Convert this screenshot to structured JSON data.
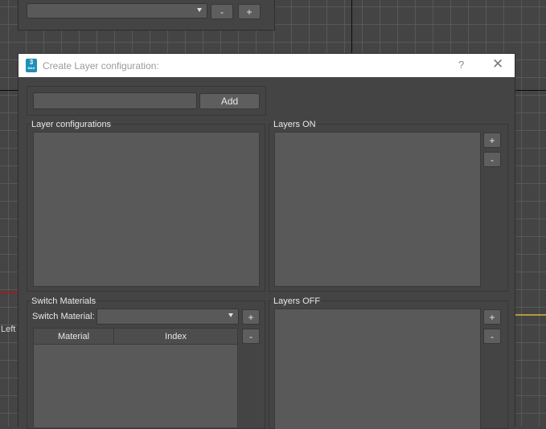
{
  "viewport": {
    "label": "Left"
  },
  "top_panel": {
    "dropdown_value": "",
    "minus_label": "-",
    "plus_label": "+"
  },
  "dialog": {
    "title": "Create Layer configuration:",
    "icon_text": "3",
    "icon_subtext": "MAX",
    "help_symbol": "?",
    "close_symbol": "✕",
    "add_input_value": "",
    "add_button_label": "Add",
    "layer_configurations": {
      "title": "Layer configurations",
      "items": []
    },
    "layers_on": {
      "title": "Layers ON",
      "plus_label": "+",
      "minus_label": "-",
      "items": []
    },
    "switch_materials": {
      "title": "Switch Materials",
      "switch_label": "Switch Material:",
      "dropdown_value": "",
      "plus_label": "+",
      "minus_label": "-",
      "columns": [
        "Material",
        "Index"
      ],
      "rows": []
    },
    "layers_off": {
      "title": "Layers OFF",
      "plus_label": "+",
      "minus_label": "-",
      "items": []
    }
  }
}
